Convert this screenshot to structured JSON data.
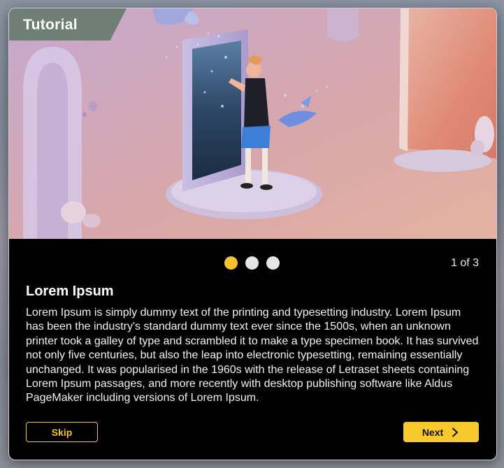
{
  "dialog": {
    "title": "Tutorial",
    "hero": {
      "icon": "illustration-person-portal-image"
    },
    "pagination": {
      "total": 3,
      "current": 1,
      "label": "1 of 3",
      "active_color": "#f5c12c",
      "inactive_color": "#e6e6e6"
    },
    "content": {
      "heading": "Lorem Ipsum",
      "body": "Lorem Ipsum is simply dummy text of the printing and typesetting industry. Lorem Ipsum has been the industry's standard dummy text ever since the 1500s, when an unknown printer took a galley of type and scrambled it to make a type specimen book. It has survived not only five centuries, but also the leap into electronic typesetting, remaining essentially unchanged. It was popularised in the 1960s with the release of Letraset sheets containing Lorem Ipsum passages, and more recently with desktop publishing software like Aldus PageMaker including versions of Lorem Ipsum."
    },
    "buttons": {
      "skip_label": "Skip",
      "next_label": "Next",
      "next_icon": "chevron-right-icon",
      "accent_color": "#f5c12c"
    }
  }
}
